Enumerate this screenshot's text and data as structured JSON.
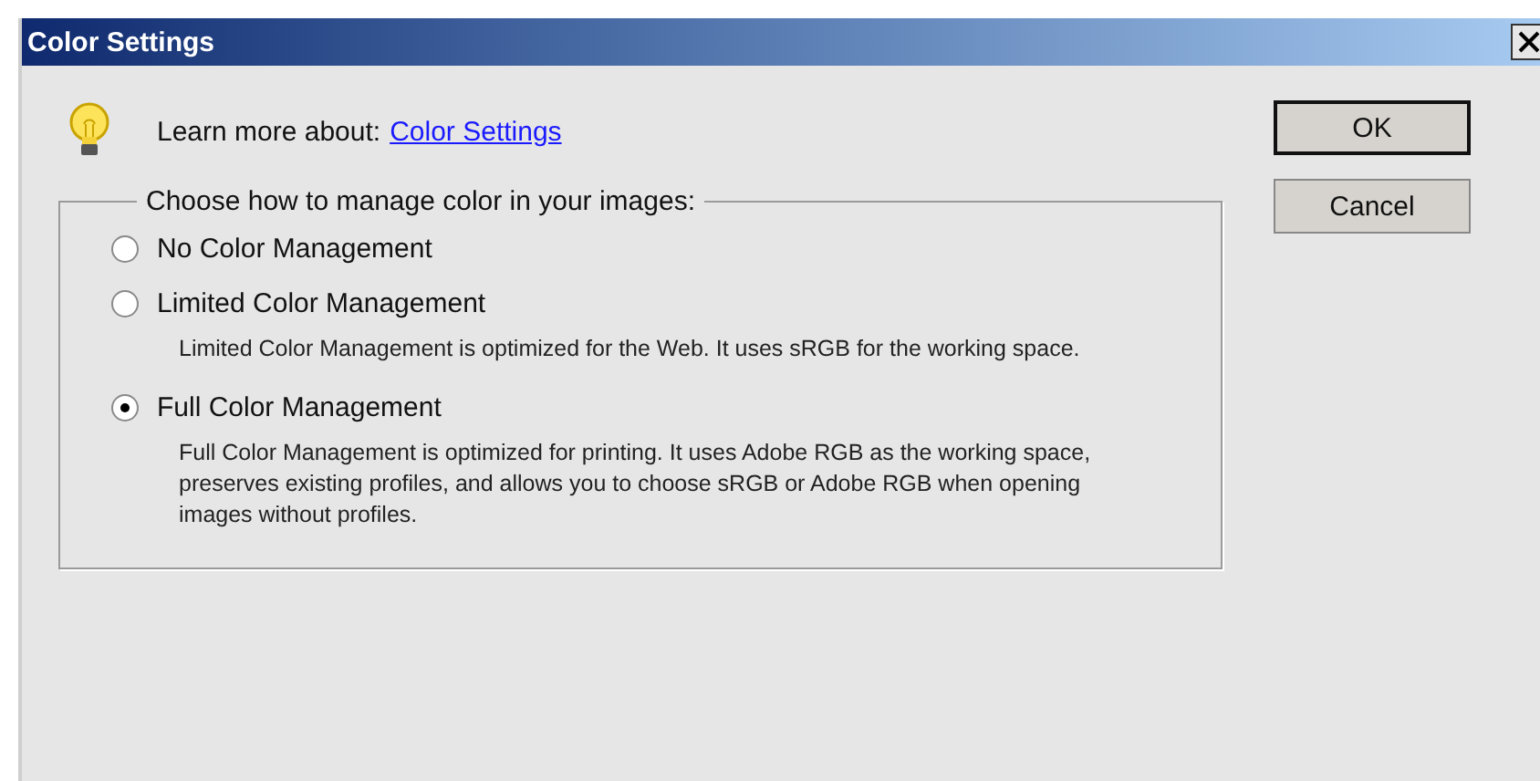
{
  "window": {
    "title": "Color Settings"
  },
  "info": {
    "text": "Learn more about:",
    "link": "Color Settings"
  },
  "group": {
    "legend": "Choose how to manage color in your images:",
    "options": [
      {
        "label": "No Color Management",
        "selected": false
      },
      {
        "label": "Limited Color Management",
        "selected": false,
        "description": "Limited Color Management is optimized for the Web. It uses sRGB for the working space."
      },
      {
        "label": "Full Color Management",
        "selected": true,
        "description": "Full Color Management is optimized for printing. It uses Adobe RGB as the working space, preserves existing profiles, and allows you to choose sRGB or Adobe RGB when opening images without profiles."
      }
    ]
  },
  "buttons": [
    {
      "label": "OK",
      "default": true
    },
    {
      "label": "Cancel",
      "default": false
    }
  ]
}
